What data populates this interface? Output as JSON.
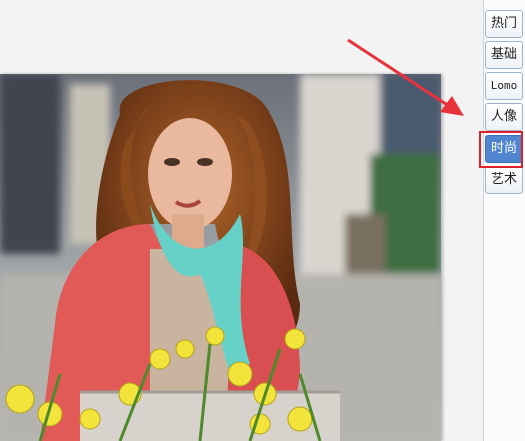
{
  "side_panel": {
    "tabs": [
      {
        "label": "热门",
        "active": false
      },
      {
        "label": "基础",
        "active": false
      },
      {
        "label": "Lomo",
        "active": false
      },
      {
        "label": "人像",
        "active": false
      },
      {
        "label": "时尚",
        "active": true
      },
      {
        "label": "艺术",
        "active": false
      }
    ]
  },
  "annotation": {
    "arrow_color": "#e8323c",
    "highlight_color": "#e0202a",
    "highlighted_tab": "时尚"
  },
  "colors": {
    "active_tab": "#4f86cf",
    "tab_border": "#9bb3cc"
  }
}
